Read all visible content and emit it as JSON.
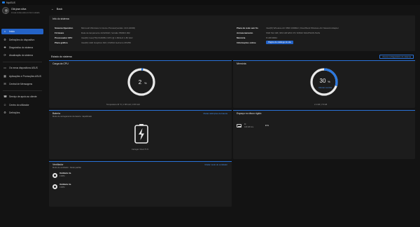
{
  "app": {
    "title": "MyASUS"
  },
  "profile": {
    "name": "Olá jose.silva",
    "status": "A sua conta está em bom estado"
  },
  "nav": [
    {
      "label": "Início",
      "icon": "home-icon",
      "glyph": "⌂",
      "active": true
    },
    {
      "label": "Definições do dispositivo",
      "icon": "settings-icon",
      "glyph": "⚙",
      "active": false
    },
    {
      "label": "Diagnóstico do sistema",
      "icon": "diagnosis-icon",
      "glyph": "✚",
      "active": false
    },
    {
      "label": "Atualização do sistema",
      "icon": "update-icon",
      "glyph": "⟳",
      "active": false
    },
    {
      "label": "Os meus dispositivos ASUS",
      "icon": "devices-icon",
      "glyph": "▭",
      "active": false
    },
    {
      "label": "Aplicações e Promoções ASUS",
      "icon": "apps-icon",
      "glyph": "▦",
      "active": false
    },
    {
      "label": "Central de Mensagens",
      "icon": "message-icon",
      "glyph": "✉",
      "active": false
    },
    {
      "label": "Serviço de apoio ao cliente",
      "icon": "support-icon",
      "glyph": "☎",
      "active": false
    },
    {
      "label": "Centro do utilizador",
      "icon": "user-icon",
      "glyph": "☺",
      "active": false
    },
    {
      "label": "Definições",
      "icon": "gear-icon",
      "glyph": "⚙",
      "active": false
    }
  ],
  "back_label": "Back",
  "sysinfo": {
    "title": "Info do sistema",
    "left": [
      {
        "key": "Sistema Operativo",
        "value": "Microsoft Windows 11 Home Preview(versão: 10.0.22000)"
      },
      {
        "key": "Firmware",
        "value": "Data de lançamento 2/24/2022 | Versão X509FJ.302"
      },
      {
        "key": "Processador CPU",
        "value": "Intel(R) Core(TM) i5-8265U CPU @ 1.60GHz 1.80 GHz"
      },
      {
        "key": "Placa gráfica",
        "value": "Intel(R) UHD Graphics 620 | NVIDIA GeForce MX250"
      }
    ],
    "right": [
      {
        "key": "Placa de rede sem fio",
        "value": "Intel(R) Wireless-AC 9560 160MHz | Dual Band Wireless-AC Network Adapter"
      },
      {
        "key": "Armazenamento",
        "value": "SSD 512 GB | 953 GB WDC PC SN520 SDAPNUW-512G"
      },
      {
        "key": "Memória",
        "value": "8 GB DDR4"
      },
      {
        "key": "Informações online",
        "value": ""
      }
    ],
    "online_button": "Página de catálogo do site"
  },
  "status": {
    "title": "Estado do sistema",
    "details_button": "Acesso à diagnóstico do sistema",
    "cpu": {
      "title": "Carga da CPU",
      "value": "2",
      "unit": "%",
      "percent": 2,
      "footer": "Temperatura 46 °C  |  1.58 GHz  |  3.05 GHz"
    },
    "memory": {
      "title": "Memória",
      "value": "30",
      "unit": "%",
      "percent": 30,
      "link": "Otimizar memória",
      "footer": "2.4 GB  |  7.8 GB"
    },
    "battery": {
      "title": "Bateria",
      "subtitle": "Modo de carregamento da bateria : Equilibrado",
      "link": "Mudar definições da bateria",
      "caption": "Carregar: Nível 73 %"
    },
    "disk": {
      "title": "Espaço no disco rígido",
      "drive_name": "C:",
      "drive_sub": "446 GB livre",
      "drive_value": "9",
      "drive_unit": "%"
    },
    "fans": {
      "title": "Ventilador",
      "subtitle": "Modo de ventilador : Modo padrão",
      "link": "Mudar modo do ventilador",
      "items": [
        {
          "name": "Ventilador da",
          "value": "0 RPM"
        },
        {
          "name": "Ventilador da",
          "value": "0 RPM"
        }
      ]
    }
  },
  "colors": {
    "accent": "#2463c7",
    "ring": "#2a78e0",
    "ring_bg": "#e9e9e9"
  }
}
